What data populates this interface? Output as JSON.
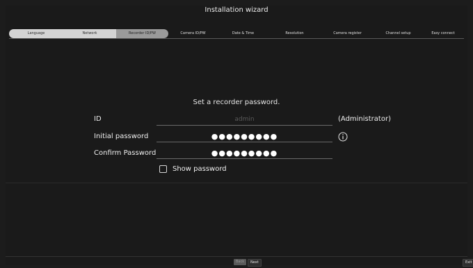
{
  "header": {
    "title": "Installation wizard"
  },
  "steps": [
    {
      "label": "Language"
    },
    {
      "label": "Network"
    },
    {
      "label": "Recorder ID/PW"
    },
    {
      "label": "Camera ID/PW"
    },
    {
      "label": "Date & Time"
    },
    {
      "label": "Resolution"
    },
    {
      "label": "Camera register"
    },
    {
      "label": "Channel setup"
    },
    {
      "label": "Easy connect"
    }
  ],
  "form": {
    "heading": "Set a recorder password.",
    "id_label": "ID",
    "id_value": "admin",
    "id_note": "(Administrator)",
    "initial_label": "Initial password",
    "initial_value": "●●●●●●●●●",
    "confirm_label": "Confirm Password",
    "confirm_value": "●●●●●●●●●",
    "show_password_label": "Show password",
    "show_password_checked": false
  },
  "footer": {
    "back": "Back",
    "next": "Next",
    "exit": "Exit"
  },
  "icons": {
    "info": "info-icon"
  }
}
